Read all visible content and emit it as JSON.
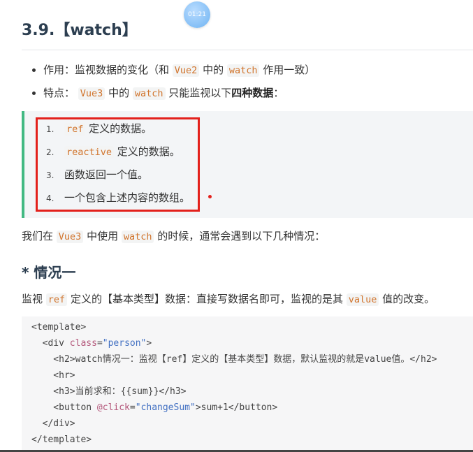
{
  "timer": {
    "label": "01:21"
  },
  "heading": {
    "number": "3.9.",
    "title": "【watch】"
  },
  "bullets": [
    {
      "label": "作用：监视数据的变化（和 ",
      "code1": "Vue2",
      "mid": " 中的 ",
      "code2": "watch",
      "end": " 作用一致）"
    },
    {
      "label": "特点：",
      "code1": "Vue3",
      "mid": " 中的 ",
      "code2": "watch",
      "end": " 只能监视以下",
      "bold": "四种数据",
      "tail": "："
    }
  ],
  "watch_sources": [
    {
      "num": "1.",
      "code": "ref",
      "text": " 定义的数据。"
    },
    {
      "num": "2.",
      "code": "reactive",
      "text": " 定义的数据。"
    },
    {
      "num": "3.",
      "code": "",
      "text": "函数返回一个值。"
    },
    {
      "num": "4.",
      "code": "",
      "text": "一个包含上述内容的数组。"
    }
  ],
  "usage_note": {
    "prefix": "我们在 ",
    "code1": "Vue3",
    "mid": " 中使用 ",
    "code2": "watch",
    "end": " 的时候，通常会遇到以下几种情况："
  },
  "case_heading": "* 情况一",
  "case_desc": {
    "prefix": "监视 ",
    "code1": "ref",
    "mid": " 定义的【基本类型】数据：直接写数据名即可，监视的是其 ",
    "code2": "value",
    "end": " 值的改变。"
  },
  "code_lines": [
    {
      "a": "<template>"
    },
    {
      "a": "  <div ",
      "attr": "class",
      "b": "=",
      "str": "\"person\"",
      "c": ">"
    },
    {
      "a": "    <h2>watch情况一：监视【ref】定义的【基本类型】数据，默认监视的就是value值。</h2>"
    },
    {
      "a": "    <hr>"
    },
    {
      "a": "    <h3>当前求和：{{sum}}</h3>"
    },
    {
      "a": "    <button ",
      "attr": "@click",
      "b": "=",
      "str": "\"changeSum\"",
      "c": ">sum+1</button>"
    },
    {
      "a": "  </div>"
    },
    {
      "a": "</template>"
    }
  ]
}
